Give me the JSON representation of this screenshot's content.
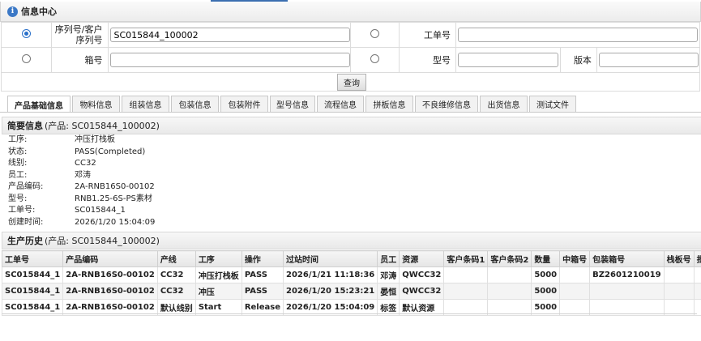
{
  "panel": {
    "title": "信息中心",
    "icon": "info-icon"
  },
  "form": {
    "serial_label": "序列号/客户序列号",
    "serial_value": "SC015844_100002",
    "workorder_label": "工单号",
    "workorder_value": "",
    "box_label": "箱号",
    "box_value": "",
    "model_label": "型号",
    "model_value": "",
    "version_label": "版本",
    "version_value": "",
    "selected": "serial",
    "query_label": "查询"
  },
  "tabs": [
    "产品基础信息",
    "物料信息",
    "组装信息",
    "包装信息",
    "包装附件",
    "型号信息",
    "流程信息",
    "拼板信息",
    "不良维修信息",
    "出货信息",
    "测试文件"
  ],
  "active_tab": 0,
  "summary": {
    "title": "简要信息",
    "subtitle": "(产品: SC015844_100002)",
    "rows": [
      {
        "k": "工序:",
        "v": "冲压打栈板"
      },
      {
        "k": "状态:",
        "v": "PASS(Completed)"
      },
      {
        "k": "线别:",
        "v": "CC32"
      },
      {
        "k": "员工:",
        "v": "邓涛"
      },
      {
        "k": "产品编码:",
        "v": "2A-RNB16S0-00102"
      },
      {
        "k": "型号:",
        "v": "RNB1.25-6S-PS素材"
      },
      {
        "k": "工单号:",
        "v": "SC015844_1"
      },
      {
        "k": "创建时间:",
        "v": "2026/1/20 15:04:09"
      }
    ]
  },
  "history": {
    "title": "生产历史",
    "subtitle": "(产品: SC015844_100002)",
    "columns": [
      "工单号",
      "产品编码",
      "产线",
      "工序",
      "操作",
      "过站时间",
      "员工",
      "资源",
      "客户条码1",
      "客户条码2",
      "数量",
      "中箱号",
      "包装箱号",
      "栈板号",
      "批次号"
    ],
    "rows": [
      [
        "SC015844_1",
        "2A-RNB16S0-00102",
        "CC32",
        "冲压打栈板",
        "PASS",
        "2026/1/21 11:18:36",
        "邓涛",
        "QWCC32",
        "",
        "",
        "5000",
        "",
        "BZ2601210019",
        "",
        ""
      ],
      [
        "SC015844_1",
        "2A-RNB16S0-00102",
        "CC32",
        "冲压",
        "PASS",
        "2026/1/20 15:23:21",
        "晏恒",
        "QWCC32",
        "",
        "",
        "5000",
        "",
        "",
        "",
        ""
      ],
      [
        "SC015844_1",
        "2A-RNB16S0-00102",
        "默认线别",
        "Start",
        "Release",
        "2026/1/20 15:04:09",
        "标签",
        "默认资源",
        "",
        "",
        "5000",
        "",
        "",
        "",
        ""
      ]
    ]
  }
}
